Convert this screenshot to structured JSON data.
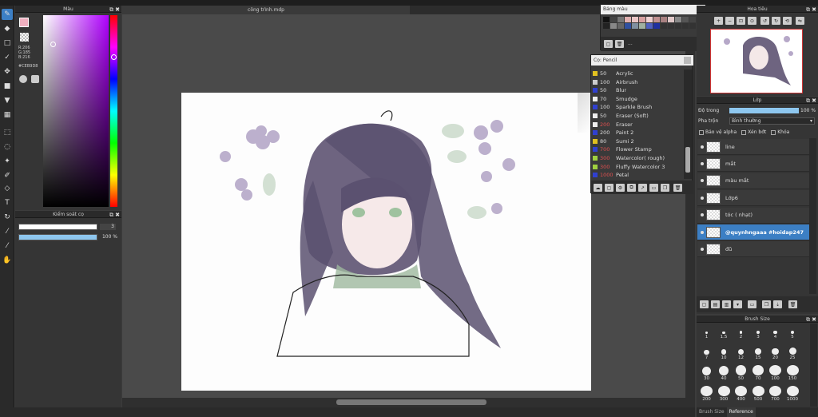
{
  "document": {
    "tab_title": "công trình.mdp"
  },
  "color_panel": {
    "title": "Màu",
    "rgb": {
      "r": "R:206",
      "g": "G:185",
      "b": "B:216"
    },
    "hex": "#CEB9D8",
    "fg_color": "#f0b0c0",
    "bg_color": "#ffffff"
  },
  "brush_control": {
    "title": "Kiểm soát cọ",
    "size_value": "3",
    "opacity_value": "100 %"
  },
  "palette_panel": {
    "title": "Bảng màu",
    "new_label": "..."
  },
  "brush_list": {
    "title": "Cọ: Pencil",
    "items": [
      {
        "size": "50",
        "name": "Acrylic",
        "color": "#e0c020",
        "size_color": "#dddddd"
      },
      {
        "size": "100",
        "name": "Airbrush",
        "color": "#cccccc",
        "size_color": "#dddddd"
      },
      {
        "size": "50",
        "name": "Blur",
        "color": "#3040d0",
        "size_color": "#dddddd"
      },
      {
        "size": "70",
        "name": "Smudge",
        "color": "#eeeeee",
        "size_color": "#dddddd"
      },
      {
        "size": "100",
        "name": "Sparkle Brush",
        "color": "#3040d0",
        "size_color": "#dddddd"
      },
      {
        "size": "50",
        "name": "Eraser (Soft)",
        "color": "#eeeeee",
        "size_color": "#dddddd"
      },
      {
        "size": "200",
        "name": "Eraser",
        "color": "#eeeeee",
        "size_color": "#e05050"
      },
      {
        "size": "200",
        "name": "Paint 2",
        "color": "#3040d0",
        "size_color": "#dddddd"
      },
      {
        "size": "80",
        "name": "Sumi 2",
        "color": "#e0c020",
        "size_color": "#dddddd"
      },
      {
        "size": "700",
        "name": "Flower Stamp",
        "color": "#3040d0",
        "size_color": "#e05050"
      },
      {
        "size": "300",
        "name": "Watercolor( rough)",
        "color": "#a0d040",
        "size_color": "#e05050"
      },
      {
        "size": "300",
        "name": "Fluffy Watercolor 3",
        "color": "#a0d040",
        "size_color": "#e05050"
      },
      {
        "size": "1000",
        "name": "Petal",
        "color": "#3040d0",
        "size_color": "#e05050"
      }
    ]
  },
  "navigator": {
    "title": "Hoa tiêu"
  },
  "layer_panel": {
    "title": "Lớp",
    "opacity_label": "Độ trong",
    "opacity_value": "100 %",
    "opacity_fraction": 1.0,
    "blend_label": "Pha trộn",
    "blend_value": "Bình thường",
    "protect_alpha": "Bảo vệ alpha",
    "clipping": "Xén bớt",
    "lock": "Khóa",
    "layers": [
      {
        "name": "line",
        "selected": false
      },
      {
        "name": "mắt",
        "selected": false
      },
      {
        "name": "màu mắt",
        "selected": false
      },
      {
        "name": "Lớp6",
        "selected": false
      },
      {
        "name": "tóc ( nhạt)",
        "selected": false
      },
      {
        "name": "@quynhngaaa #hoidap247",
        "selected": true
      },
      {
        "name": "đũ",
        "selected": false
      }
    ]
  },
  "brush_size": {
    "title": "Brush Size",
    "sizes": [
      "1",
      "1.5",
      "2",
      "3",
      "4",
      "5",
      "7",
      "10",
      "12",
      "15",
      "20",
      "25",
      "30",
      "40",
      "50",
      "70",
      "100",
      "150",
      "200",
      "300",
      "400",
      "500",
      "700",
      "1000"
    ],
    "tabs": {
      "a": "Brush Size",
      "b": "Reference"
    }
  }
}
